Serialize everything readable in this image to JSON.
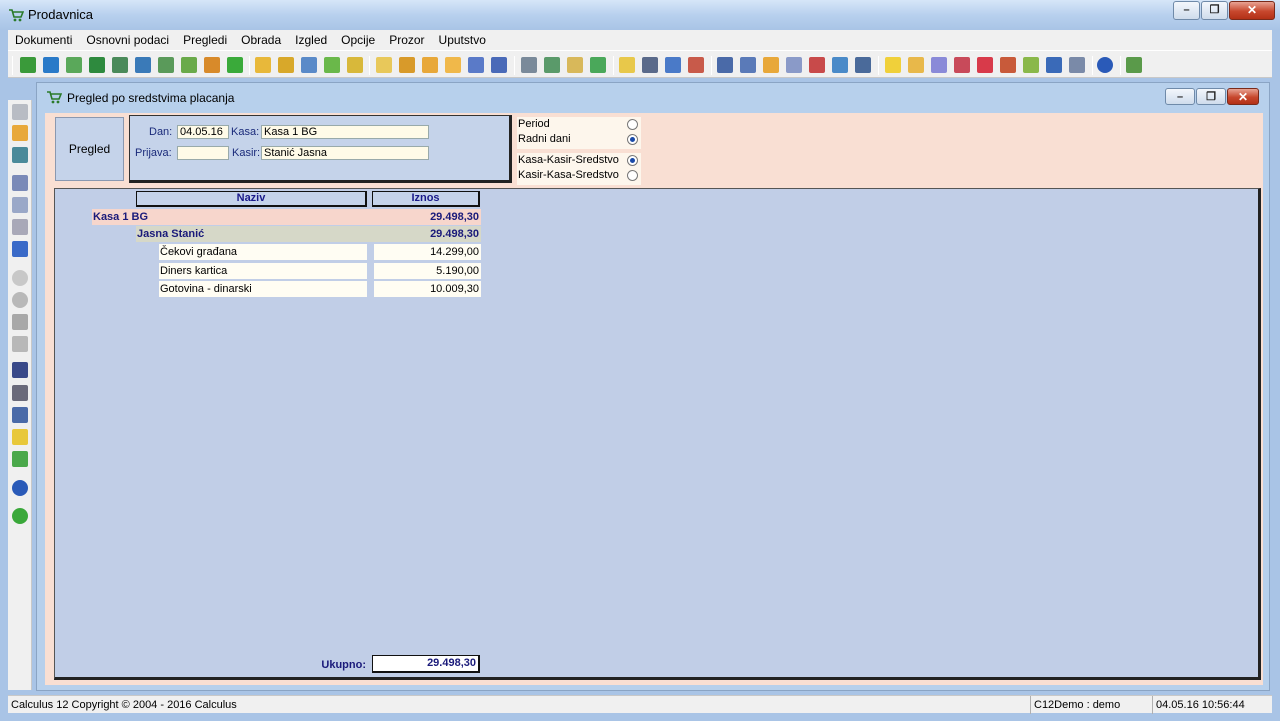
{
  "app": {
    "title": "Prodavnica"
  },
  "menu": [
    "Dokumenti",
    "Osnovni podaci",
    "Pregledi",
    "Obrada",
    "Izgled",
    "Opcije",
    "Prozor",
    "Uputstvo"
  ],
  "child": {
    "title": "Pregled po sredstvima placanja"
  },
  "form": {
    "pregled_button": "Pregled",
    "dan_label": "Dan:",
    "dan_value": "04.05.16",
    "kasa_label": "Kasa:",
    "kasa_value": "Kasa 1 BG",
    "prijava_label": "Prijava:",
    "prijava_value": "",
    "kasir_label": "Kasir:",
    "kasir_value": "Stanić Jasna"
  },
  "period_options": [
    {
      "label": "Period",
      "selected": false
    },
    {
      "label": "Radni dani",
      "selected": true
    }
  ],
  "grouping_options": [
    {
      "label": "Kasa-Kasir-Sredstvo",
      "selected": true
    },
    {
      "label": "Kasir-Kasa-Sredstvo",
      "selected": false
    }
  ],
  "report": {
    "columns": {
      "naziv": "Naziv",
      "iznos": "Iznos"
    },
    "kasa": {
      "name": "Kasa 1 BG",
      "amount": "29.498,30"
    },
    "kasir": {
      "name": "Jasna Stanić",
      "amount": "29.498,30"
    },
    "items": [
      {
        "name": "Čekovi građana",
        "amount": "14.299,00"
      },
      {
        "name": "Diners kartica",
        "amount": "5.190,00"
      },
      {
        "name": "Gotovina - dinarski",
        "amount": "10.009,30"
      }
    ],
    "total_label": "Ukupno:",
    "total_value": "29.498,30"
  },
  "status": {
    "copyright": "Calculus 12  Copyright © 2004 - 2016  Calculus",
    "user": "C12Demo : demo",
    "datetime": "04.05.16 10:56:44"
  },
  "colors": {
    "accent": "#1a1a7a",
    "form_bg": "#f9dfd3",
    "report_bg": "#c1cee7",
    "kasa_row": "#f7d6cc",
    "kasir_row": "#d6d8c8"
  }
}
